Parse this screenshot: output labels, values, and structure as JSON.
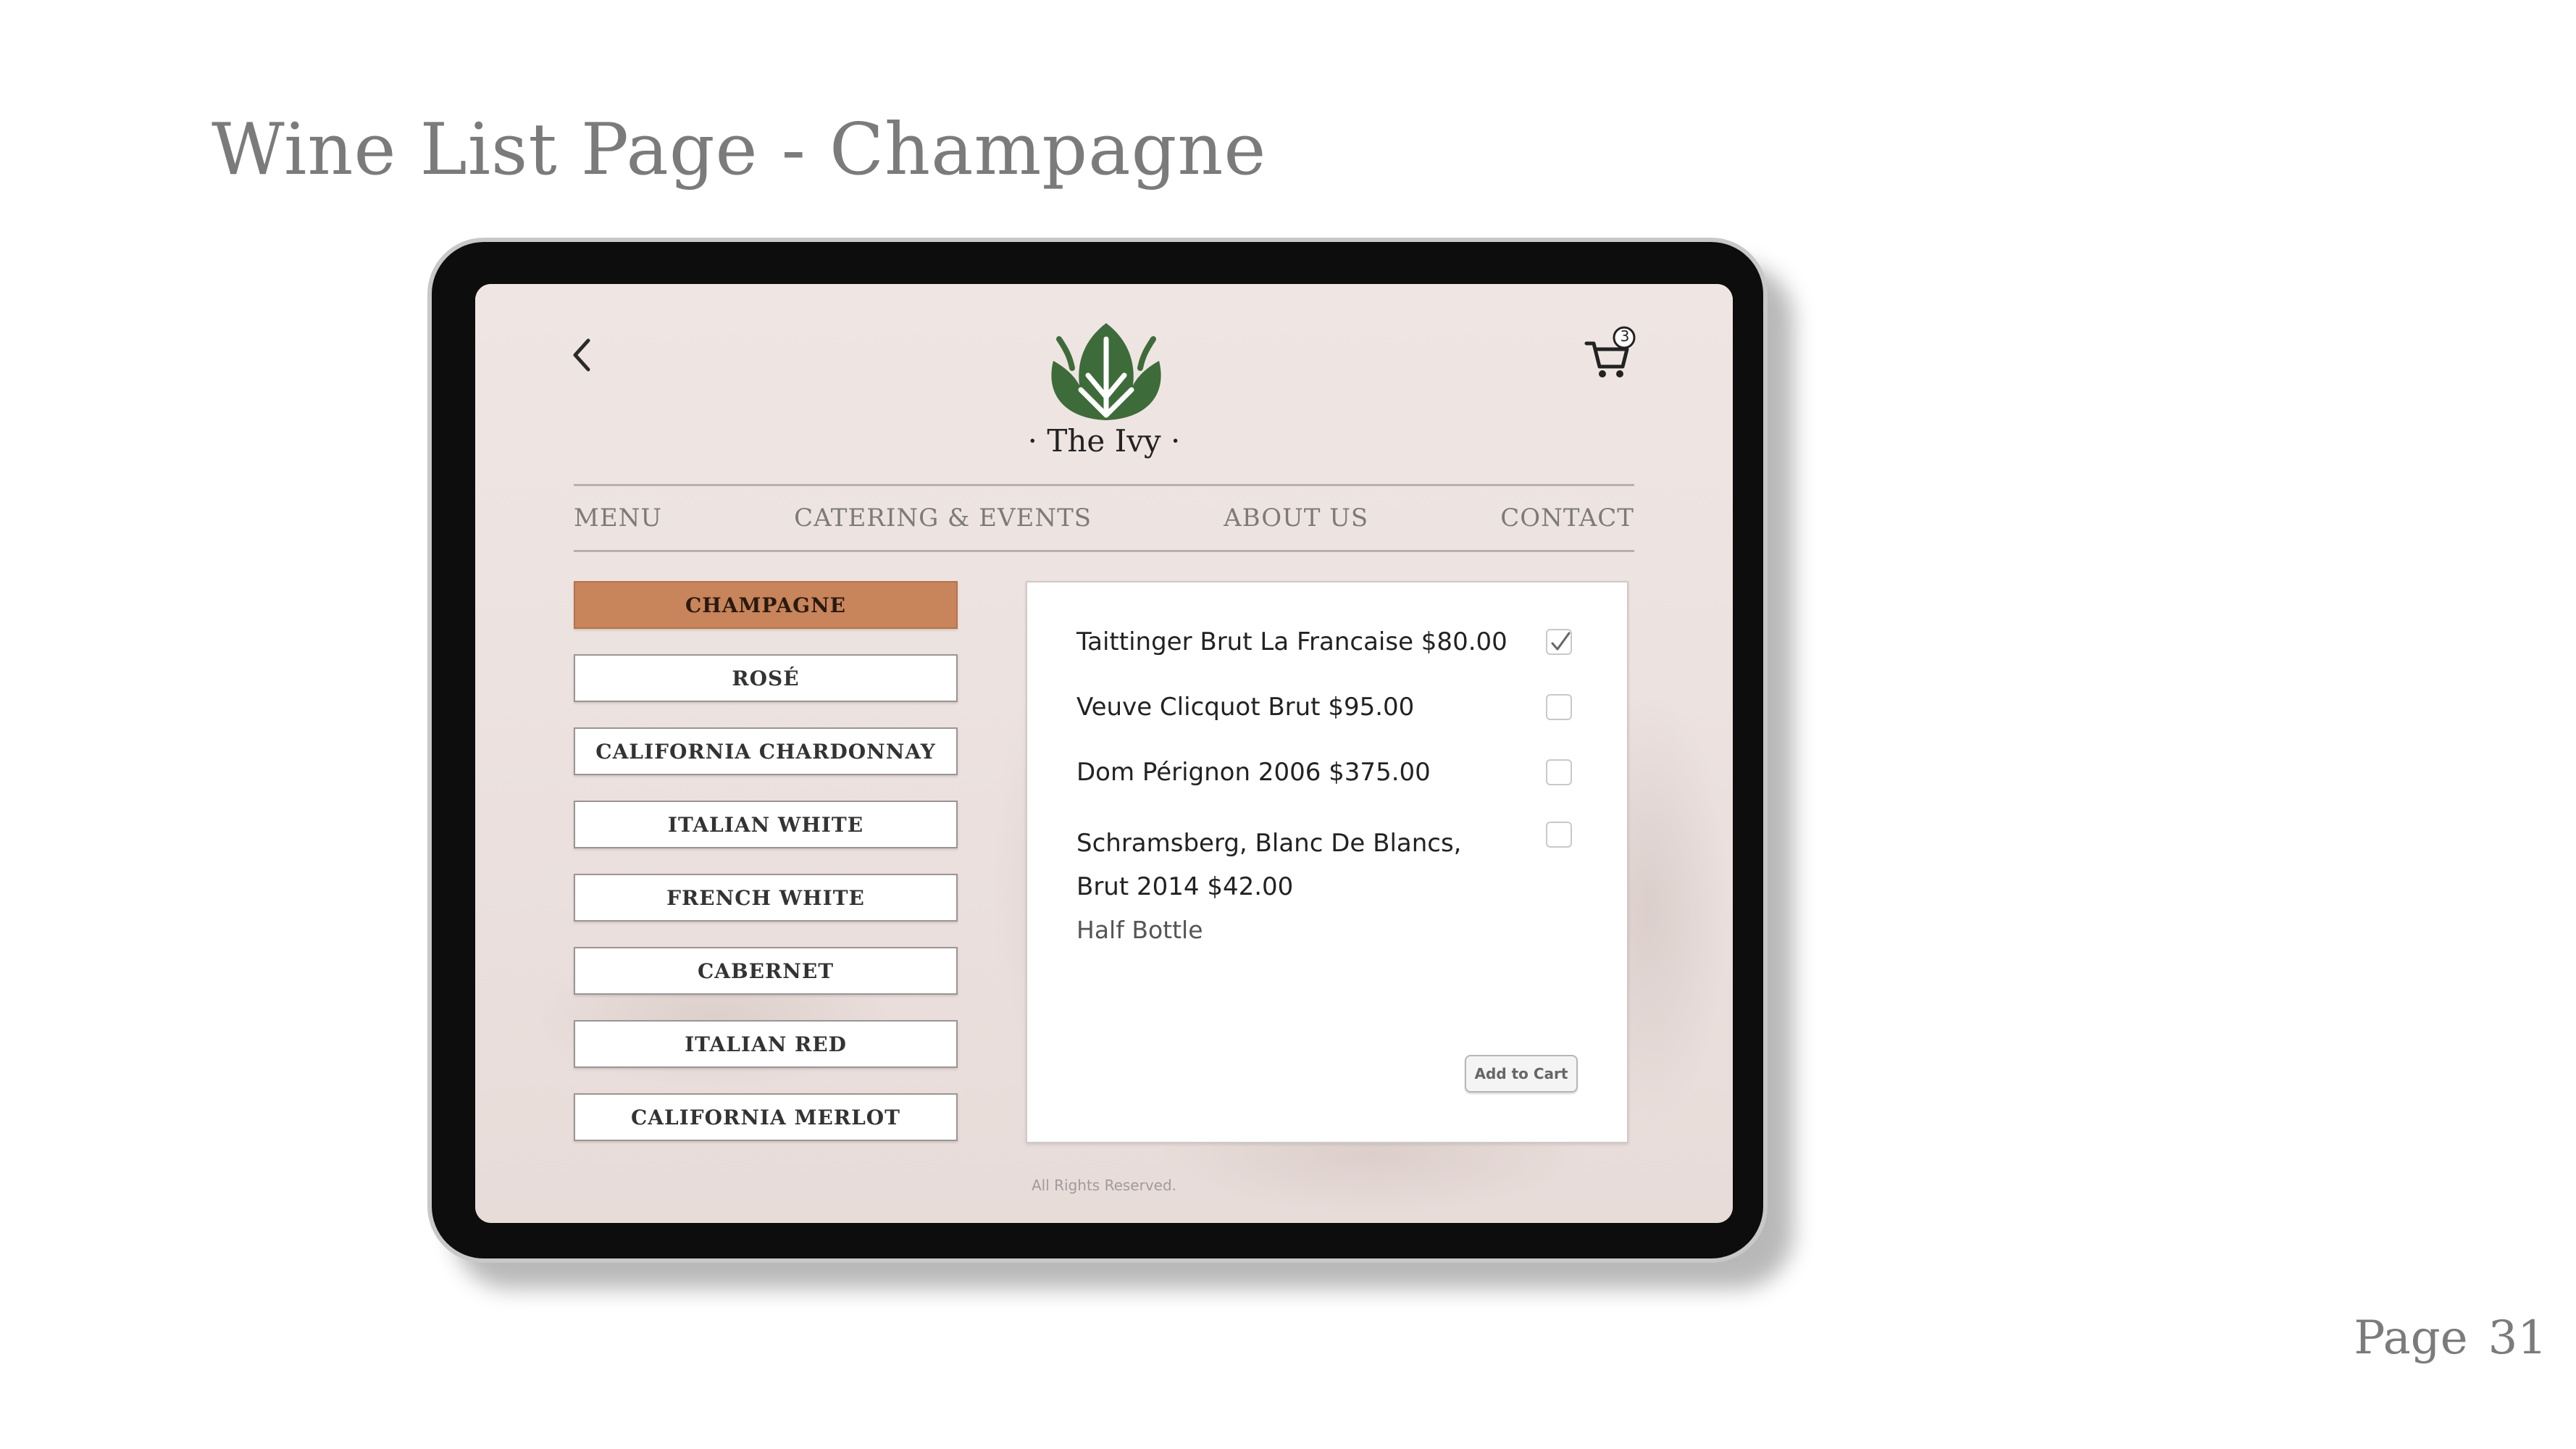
{
  "slide": {
    "title": "Wine List Page - Champagne",
    "page_label": "Page",
    "page_number": "31"
  },
  "app": {
    "brand": "· The Ivy ·",
    "cart_count": "3",
    "nav": [
      "MENU",
      "CATERING & EVENTS",
      "ABOUT US",
      "CONTACT"
    ],
    "categories": [
      {
        "label": "CHAMPAGNE",
        "active": true
      },
      {
        "label": "ROSÉ",
        "active": false
      },
      {
        "label": "CALIFORNIA CHARDONNAY",
        "active": false
      },
      {
        "label": "ITALIAN WHITE",
        "active": false
      },
      {
        "label": "FRENCH WHITE",
        "active": false
      },
      {
        "label": "CABERNET",
        "active": false
      },
      {
        "label": "ITALIAN RED",
        "active": false
      },
      {
        "label": "CALIFORNIA MERLOT",
        "active": false
      }
    ],
    "wines": [
      {
        "name": "Taittinger Brut La Francaise $80.00",
        "checked": true
      },
      {
        "name": "Veuve Clicquot Brut $95.00",
        "checked": false
      },
      {
        "name": "Dom Pérignon 2006 $375.00",
        "checked": false
      },
      {
        "name": "Schramsberg, Blanc De Blancs, Brut 2014 $42.00",
        "note": "Half Bottle",
        "checked": false
      }
    ],
    "add_to_cart_label": "Add to Cart",
    "footer": "All Rights Reserved.",
    "colors": {
      "accent": "#c8845a",
      "logo_green": "#3e6b3a",
      "background": "#ece2e0"
    },
    "icons": {
      "back": "chevron-left-icon",
      "cart": "shopping-cart-icon",
      "check": "checkmark-icon",
      "logo": "leaf-logo-icon"
    }
  }
}
